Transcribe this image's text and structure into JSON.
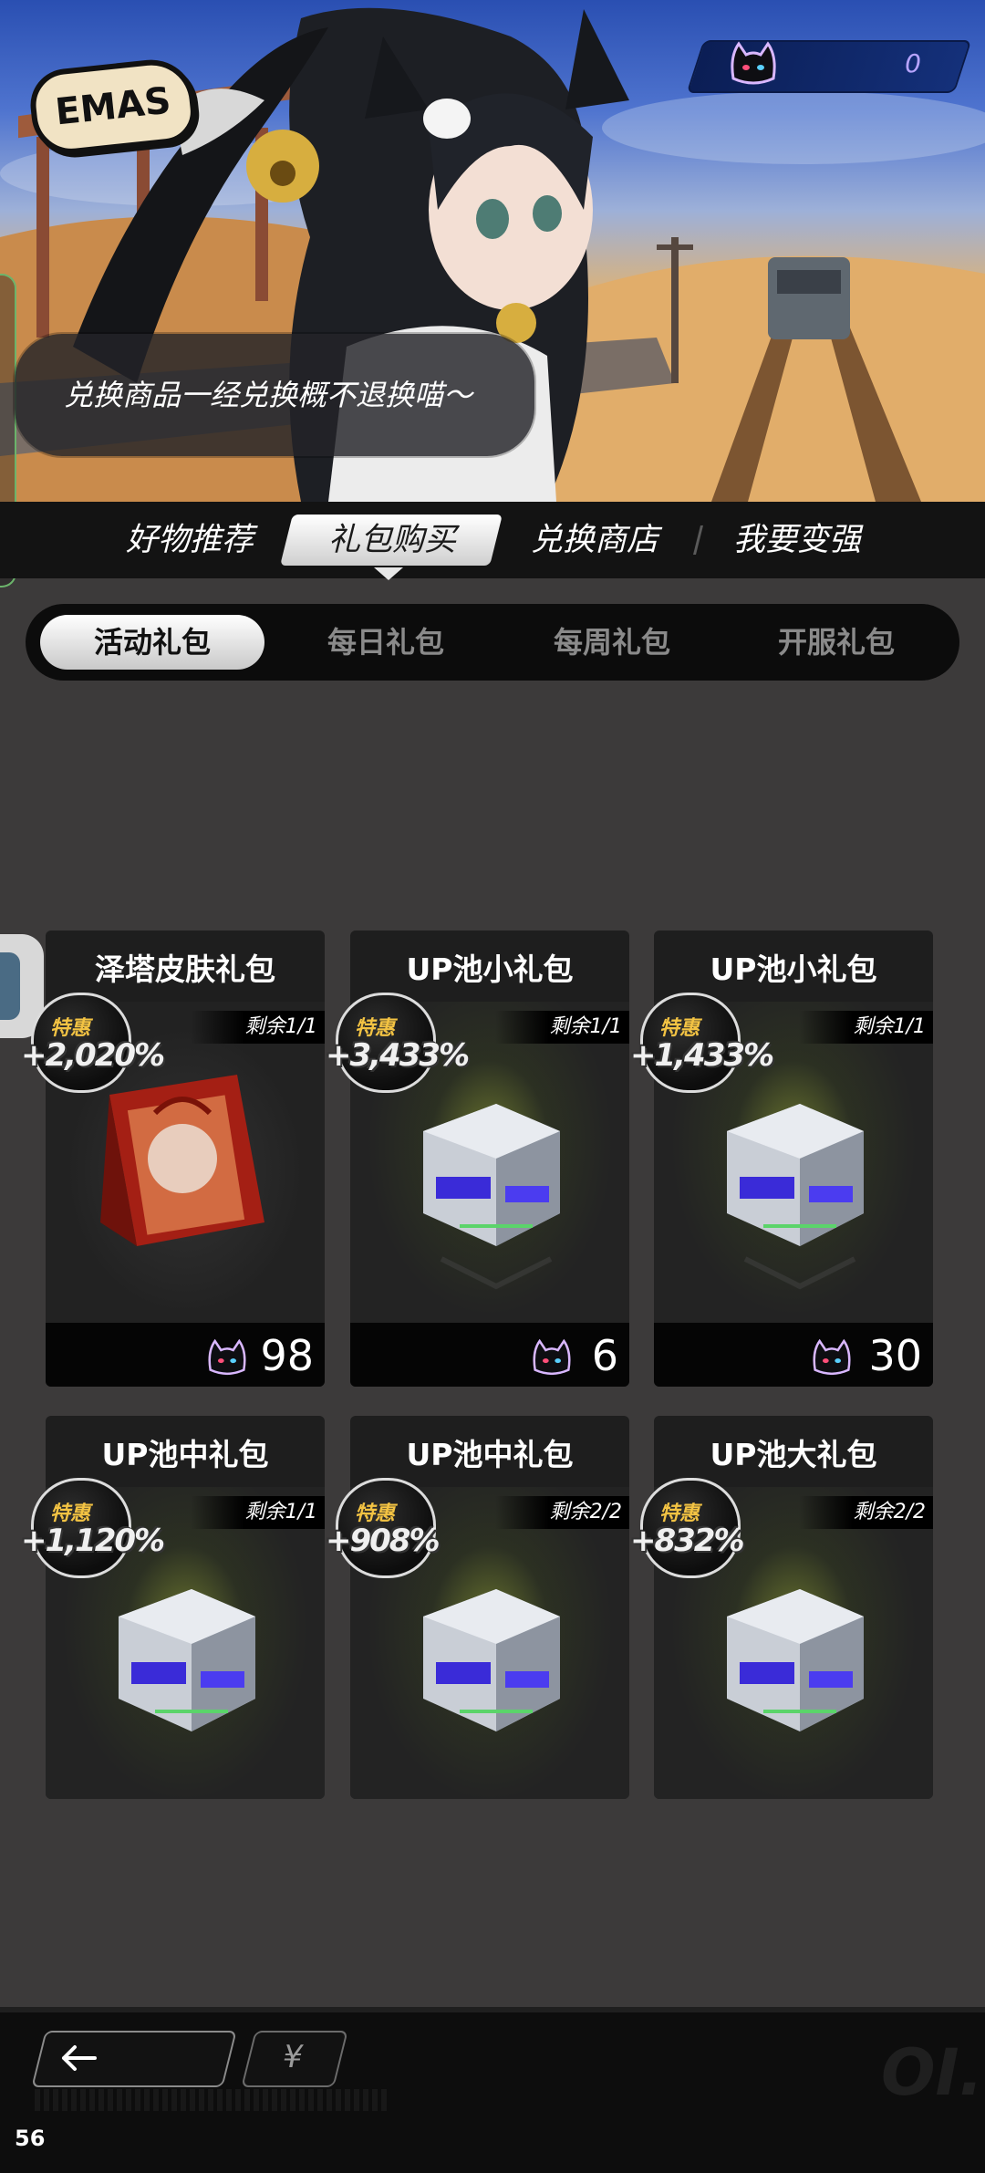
{
  "header": {
    "logo_text": "EMAS",
    "currency_value": "0",
    "speech": "兑换商品一经兑换概不退换喵～"
  },
  "nav": {
    "items": [
      {
        "label": "好物推荐",
        "active": false
      },
      {
        "label": "礼包购买",
        "active": true
      },
      {
        "label": "兑换商店",
        "active": false
      },
      {
        "label": "我要变强",
        "active": false
      }
    ]
  },
  "subtabs": [
    {
      "label": "活动礼包",
      "active": true
    },
    {
      "label": "每日礼包",
      "active": false
    },
    {
      "label": "每周礼包",
      "active": false
    },
    {
      "label": "开服礼包",
      "active": false
    }
  ],
  "cards": [
    {
      "title": "泽塔皮肤礼包",
      "badge_label": "特惠",
      "badge_value": "+2,020%",
      "stock": "剩余1/1",
      "price": "98",
      "art": "gift-bag"
    },
    {
      "title": "UP池小礼包",
      "badge_label": "特惠",
      "badge_value": "+3,433%",
      "stock": "剩余1/1",
      "price": "6",
      "art": "crate"
    },
    {
      "title": "UP池小礼包",
      "badge_label": "特惠",
      "badge_value": "+1,433%",
      "stock": "剩余1/1",
      "price": "30",
      "art": "crate"
    },
    {
      "title": "UP池中礼包",
      "badge_label": "特惠",
      "badge_value": "+1,120%",
      "stock": "剩余1/1",
      "art": "crate"
    },
    {
      "title": "UP池中礼包",
      "badge_label": "特惠",
      "badge_value": "+908%",
      "stock": "剩余2/2",
      "art": "crate"
    },
    {
      "title": "UP池大礼包",
      "badge_label": "特惠",
      "badge_value": "+832%",
      "stock": "剩余2/2",
      "art": "crate"
    }
  ],
  "bottom": {
    "back_icon": "arrow-left-icon",
    "yen_label": "¥",
    "watermark": "OI.",
    "fps": "56"
  },
  "colors": {
    "accent_badge": "#f3c343",
    "nav_bg": "#131313",
    "page_bg": "#3c3a3a"
  }
}
